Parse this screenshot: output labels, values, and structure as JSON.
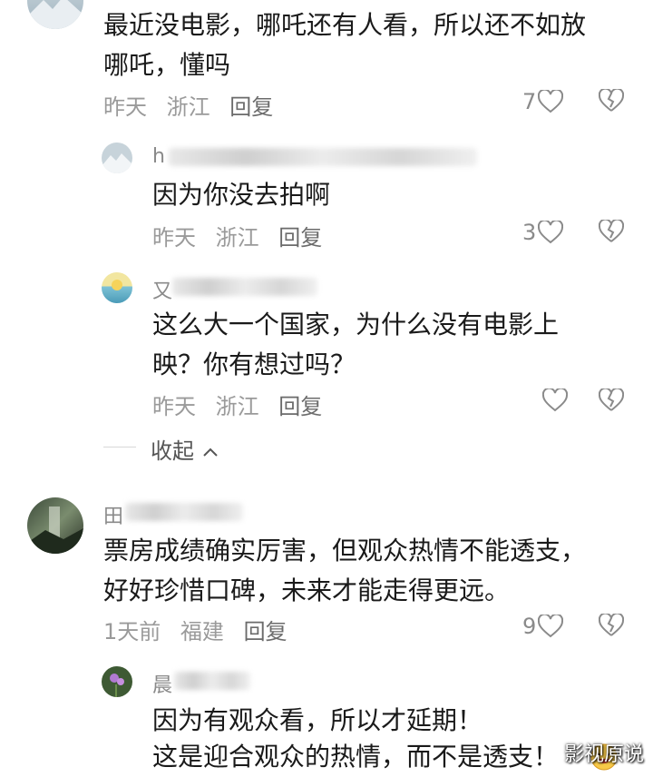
{
  "comments": [
    {
      "lines": [
        "最近没电影，哪吒还有人看，所以还不如放",
        "哪吒，懂吗"
      ],
      "date": "昨天",
      "location": "浙江",
      "reply_label": "回复",
      "likes": "7"
    },
    {
      "name": "h",
      "lines": [
        "因为你没去拍啊"
      ],
      "date": "昨天",
      "location": "浙江",
      "reply_label": "回复",
      "likes": "3"
    },
    {
      "name": "又",
      "lines": [
        "这么大一个国家，为什么没有电影上",
        "映？你有想过吗？"
      ],
      "date": "昨天",
      "location": "浙江",
      "reply_label": "回复",
      "likes": ""
    },
    {
      "name": "田",
      "lines": [
        "票房成绩确实厉害，但观众热情不能透支，",
        "好好珍惜口碑，未来才能走得更远。"
      ],
      "date": "1天前",
      "location": "福建",
      "reply_label": "回复",
      "likes": "9"
    },
    {
      "name": "晨",
      "lines": [
        "因为有观众看，所以才延期！",
        "这是迎合观众的热情，而不是透支！"
      ]
    }
  ],
  "collapse_label": "收起",
  "collapse_icon": "chevron-up-icon",
  "emoji_icon": "laughing-face-icon",
  "watermark": "影视原说",
  "colors": {
    "meta": "#9a9a9a",
    "text": "#1a1a1a",
    "icon": "#8a8a8a"
  }
}
